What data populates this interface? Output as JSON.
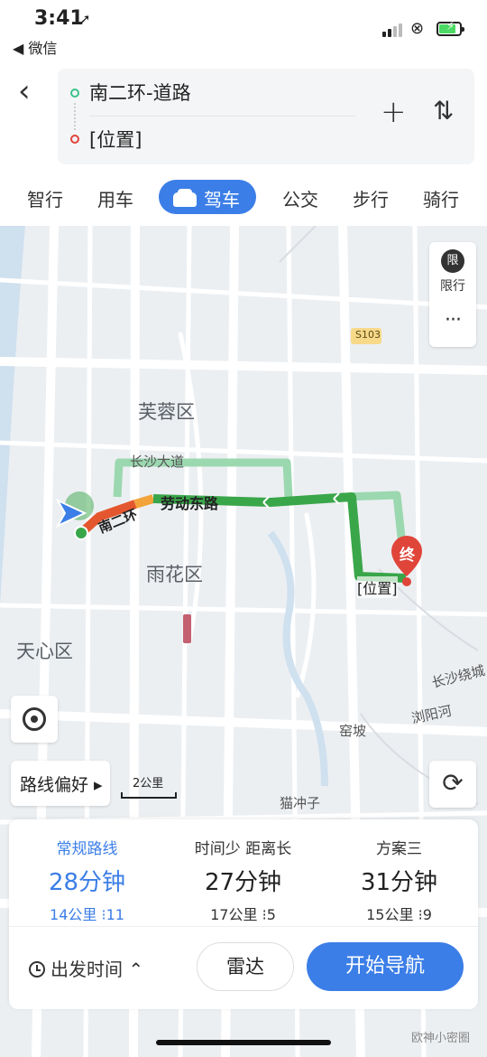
{
  "status_bar": {
    "time": "3:41",
    "back_app": "◀ 微信"
  },
  "route": {
    "from": "南二环-道路",
    "to": "[位置]"
  },
  "modes": [
    "智行",
    "用车",
    "驾车",
    "公交",
    "步行",
    "骑行"
  ],
  "active_mode": "驾车",
  "map": {
    "limit_badge": "限",
    "limit_label": "限行",
    "more": "···",
    "labels": {
      "furong": "芙蓉区",
      "yuhua": "雨花区",
      "tianxin": "天心区",
      "changsha_ave": "长沙大道",
      "south_ring": "南二环",
      "laodong_east": "劳动东路",
      "dest_label": "[位置]",
      "dest_pin": "终",
      "wopo": "窑坡",
      "maochongzi": "猫冲子",
      "liuyang_river": "浏阳河",
      "changsha_ring": "长沙绕城",
      "s103": "S103"
    },
    "route_preference": "路线偏好 ▸",
    "scale": "2公里"
  },
  "plans": [
    {
      "tag": "常规路线",
      "time": "28分钟",
      "distance": "14公里",
      "lights": "11"
    },
    {
      "tag": "时间少 距离长",
      "time": "27分钟",
      "distance": "17公里",
      "lights": "5"
    },
    {
      "tag": "方案三",
      "time": "31分钟",
      "distance": "15公里",
      "lights": "9"
    }
  ],
  "bottom": {
    "depart_time": "出发时间 ⌃",
    "radar": "雷达",
    "start_nav": "开始导航"
  },
  "watermark": "欧神小密圈",
  "colors": {
    "accent": "#3b7ee7",
    "route_main": "#3aa64a",
    "route_alt": "#9bd8b0",
    "destination": "#e0453a"
  }
}
